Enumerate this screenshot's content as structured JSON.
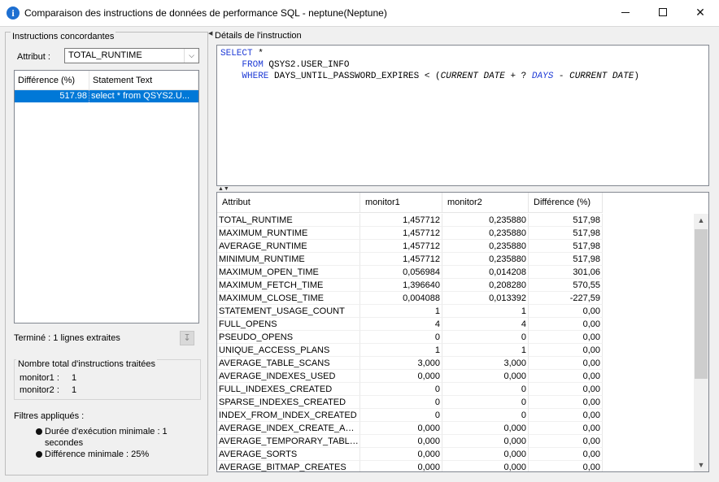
{
  "window": {
    "title": "Comparaison des instructions de données de performance SQL - neptune(Neptune)"
  },
  "left": {
    "section_title": "Instructions concordantes",
    "attribute_label": "Attribut :",
    "attribute_value": "TOTAL_RUNTIME",
    "list_headers": [
      "Différence (%)",
      "Statement Text"
    ],
    "statements": [
      {
        "diff": "517.98",
        "text": "select * from   QSYS2.U..."
      }
    ],
    "status": "Terminé : 1 lignes extraites",
    "totals_title": "Nombre total d'instructions traitées",
    "monitors": [
      {
        "label": "monitor1 :",
        "value": "1"
      },
      {
        "label": "monitor2 :",
        "value": "1"
      }
    ],
    "filters_title": "Filtres appliqués :",
    "filters": [
      "Durée d'exécution minimale : 1 secondes",
      "Différence minimale : 25%"
    ]
  },
  "right": {
    "section_title": "Détails de l'instruction",
    "sql": {
      "select": "SELECT",
      "star": " *",
      "from": "FROM",
      "table": " QSYS2.USER_INFO",
      "where": "WHERE",
      "cond_a": " DAYS_UNTIL_PASSWORD_EXPIRES < (",
      "current_date_1": "CURRENT DATE",
      "plus": " + ? ",
      "days": "DAYS",
      "minus": " - ",
      "current_date_2": "CURRENT DATE",
      "close": ")"
    },
    "grid_headers": [
      "Attribut",
      "monitor1",
      "monitor2",
      "Différence (%)"
    ],
    "rows": [
      [
        "TOTAL_RUNTIME",
        "1,457712",
        "0,235880",
        "517,98"
      ],
      [
        "MAXIMUM_RUNTIME",
        "1,457712",
        "0,235880",
        "517,98"
      ],
      [
        "AVERAGE_RUNTIME",
        "1,457712",
        "0,235880",
        "517,98"
      ],
      [
        "MINIMUM_RUNTIME",
        "1,457712",
        "0,235880",
        "517,98"
      ],
      [
        "MAXIMUM_OPEN_TIME",
        "0,056984",
        "0,014208",
        "301,06"
      ],
      [
        "MAXIMUM_FETCH_TIME",
        "1,396640",
        "0,208280",
        "570,55"
      ],
      [
        "MAXIMUM_CLOSE_TIME",
        "0,004088",
        "0,013392",
        "-227,59"
      ],
      [
        "STATEMENT_USAGE_COUNT",
        "1",
        "1",
        "0,00"
      ],
      [
        "FULL_OPENS",
        "4",
        "4",
        "0,00"
      ],
      [
        "PSEUDO_OPENS",
        "0",
        "0",
        "0,00"
      ],
      [
        "UNIQUE_ACCESS_PLANS",
        "1",
        "1",
        "0,00"
      ],
      [
        "AVERAGE_TABLE_SCANS",
        "3,000",
        "3,000",
        "0,00"
      ],
      [
        "AVERAGE_INDEXES_USED",
        "0,000",
        "0,000",
        "0,00"
      ],
      [
        "FULL_INDEXES_CREATED",
        "0",
        "0",
        "0,00"
      ],
      [
        "SPARSE_INDEXES_CREATED",
        "0",
        "0",
        "0,00"
      ],
      [
        "INDEX_FROM_INDEX_CREATED",
        "0",
        "0",
        "0,00"
      ],
      [
        "AVERAGE_INDEX_CREATE_ADVI...",
        "0,000",
        "0,000",
        "0,00"
      ],
      [
        "AVERAGE_TEMPORARY_TABLES",
        "0,000",
        "0,000",
        "0,00"
      ],
      [
        "AVERAGE_SORTS",
        "0,000",
        "0,000",
        "0,00"
      ],
      [
        "AVERAGE_BITMAP_CREATES",
        "0,000",
        "0,000",
        "0,00"
      ]
    ]
  },
  "colors": {
    "selection": "#0078d7",
    "keyword": "#1f3bd6",
    "panel_bg": "#f0f0f0"
  }
}
